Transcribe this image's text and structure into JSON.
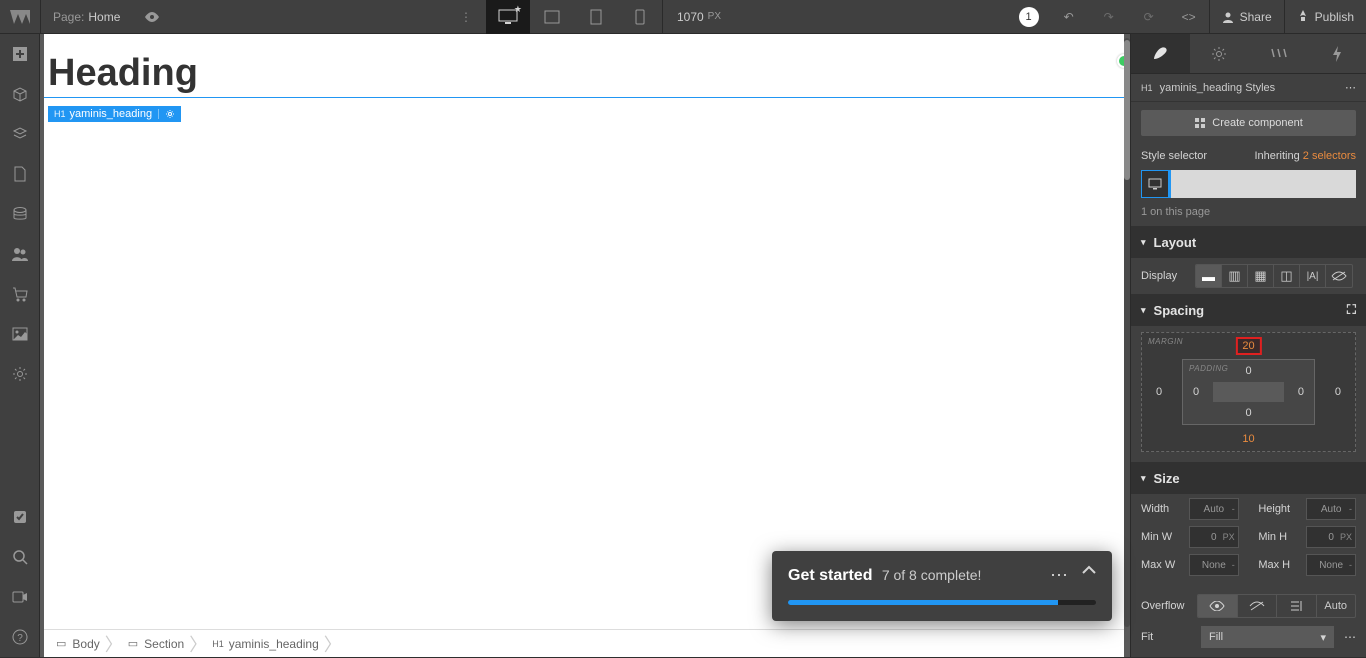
{
  "topbar": {
    "page_label": "Page:",
    "page_name": "Home",
    "viewport_width": "1070",
    "viewport_unit": "PX",
    "notif_count": "1",
    "share": "Share",
    "publish": "Publish"
  },
  "canvas": {
    "heading_text": "Heading",
    "badge_tag": "H1",
    "badge_name": "yaminis_heading"
  },
  "breadcrumb": {
    "body": "Body",
    "section": "Section",
    "el_tag": "H1",
    "el_name": "yaminis_heading"
  },
  "get_started": {
    "title": "Get started",
    "subtitle": "7 of 8 complete!"
  },
  "right_panel": {
    "header_tag": "H1",
    "header_name": "yaminis_heading Styles",
    "create_component": "Create component",
    "style_selector_label": "Style selector",
    "inheriting_label": "Inheriting",
    "inheriting_count": "2 selectors",
    "on_page": "1 on this page",
    "layout_title": "Layout",
    "display_label": "Display",
    "spacing_title": "Spacing",
    "margin_label": "MARGIN",
    "padding_label": "PADDING",
    "margin": {
      "top": "20",
      "right": "0",
      "bottom": "10",
      "left": "0"
    },
    "padding": {
      "top": "0",
      "right": "0",
      "bottom": "0",
      "left": "0"
    },
    "size_title": "Size",
    "size": {
      "width_lbl": "Width",
      "width_val": "Auto",
      "height_lbl": "Height",
      "height_val": "Auto",
      "minw_lbl": "Min W",
      "minw_val": "0",
      "minw_unit": "PX",
      "minh_lbl": "Min H",
      "minh_val": "0",
      "minh_unit": "PX",
      "maxw_lbl": "Max W",
      "maxw_val": "None",
      "maxh_lbl": "Max H",
      "maxh_val": "None"
    },
    "overflow_lbl": "Overflow",
    "overflow_auto": "Auto",
    "fit_lbl": "Fit",
    "fit_val": "Fill"
  }
}
